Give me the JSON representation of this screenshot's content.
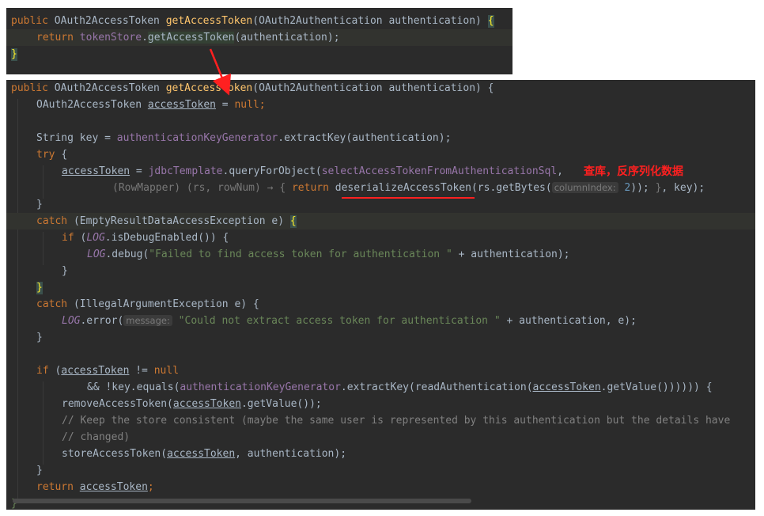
{
  "top_snippet": {
    "line1": {
      "kw_public": "public ",
      "type": "OAuth2AccessToken ",
      "fn": "getAccessToken",
      "params": "(OAuth2Authentication authentication) ",
      "brace": "{"
    },
    "line2": {
      "kw_return": "return ",
      "field": "tokenStore",
      "dot": ".",
      "method": "getAccessToken",
      "args": "(authentication);"
    },
    "line3": {
      "brace": "}"
    }
  },
  "main_code": {
    "l1": {
      "kw": "public ",
      "type": "OAuth2AccessToken ",
      "fn": "getAccessToken",
      "params": "(OAuth2Authentication authentication) {"
    },
    "l2": {
      "type": "OAuth2AccessToken ",
      "var": "accessToken",
      "eq": " = ",
      "kw_null": "null",
      "semi": ";"
    },
    "l3": {
      "text": ""
    },
    "l4": {
      "type": "String key = ",
      "field": "authenticationKeyGenerator",
      "rest": ".extractKey(authentication);"
    },
    "l5": {
      "kw": "try ",
      "brace": "{"
    },
    "l6": {
      "var": "accessToken",
      "eq": " = ",
      "field": "jdbcTemplate",
      "call": ".queryForObject(",
      "field2": "selectAccessTokenFromAuthenticationSql",
      "comma": ","
    },
    "l7": {
      "fold": "(RowMapper) (rs, rowNum) → { ",
      "kw": "return ",
      "method": "deserializeAccessToken",
      "call": "(rs.getBytes(",
      "hint": "columnIndex:",
      "num": " 2",
      "close": ")); ",
      "fold_end": "}",
      "rest": ", key);"
    },
    "l8": {
      "brace": "}"
    },
    "l9": {
      "kw": "catch ",
      "rest": "(EmptyResultDataAccessException e) ",
      "brace": "{"
    },
    "l10": {
      "kw": "if ",
      "paren": "(",
      "static": "LOG",
      "rest": ".isDebugEnabled()) {"
    },
    "l11": {
      "static": "LOG",
      "call": ".debug(",
      "str": "\"Failed to find access token for authentication \"",
      "rest": " + authentication);"
    },
    "l12": {
      "brace": "}"
    },
    "l13": {
      "brace": "}"
    },
    "l14": {
      "kw": "catch ",
      "rest": "(IllegalArgumentException e) {"
    },
    "l15": {
      "static": "LOG",
      "call": ".error(",
      "hint": "message:",
      "str": " \"Could not extract access token for authentication \"",
      "rest": " + authentication, e);"
    },
    "l16": {
      "brace": "}"
    },
    "l17": {
      "text": ""
    },
    "l18": {
      "kw": "if ",
      "paren": "(",
      "var": "accessToken",
      "neq": " != ",
      "kw_null": "null"
    },
    "l19": {
      "pre": "&& !key.equals(",
      "field": "authenticationKeyGenerator",
      "call": ".extractKey(readAuthentication(",
      "var": "accessToken",
      "rest": ".getValue()))))) {"
    },
    "l20": {
      "call": "removeAccessToken(",
      "var": "accessToken",
      "rest": ".getValue());"
    },
    "l21": {
      "cmt": "// Keep the store consistent (maybe the same user is represented by this authentication but the details have"
    },
    "l22": {
      "cmt": "// changed)"
    },
    "l23": {
      "call": "storeAccessToken(",
      "var": "accessToken",
      "rest": ", authentication);"
    },
    "l24": {
      "brace": "}"
    },
    "l25": {
      "kw": "return ",
      "var": "accessToken",
      "semi": ";"
    },
    "l26": {
      "brace": "}"
    }
  },
  "annotation": {
    "text": "查库，反序列化数据",
    "color": "#ff2020"
  },
  "theme": {
    "background": "#2b2b2b",
    "keyword": "#cc7832",
    "function": "#ffc66d",
    "field": "#9876aa",
    "string": "#6a8759",
    "comment": "#808080",
    "default": "#a9b7c6"
  }
}
